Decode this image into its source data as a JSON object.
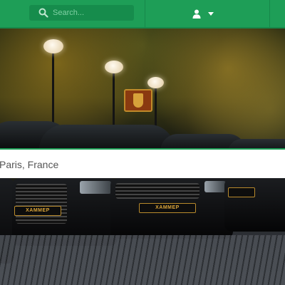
{
  "navbar": {
    "search": {
      "placeholder": "Search...",
      "icon": "search-icon"
    },
    "user_menu": {
      "icon": "user-icon",
      "dropdown_icon": "caret-down-icon"
    },
    "colors": {
      "background": "#1e9e57",
      "search_background": "#168c4c"
    }
  },
  "hero": {
    "emblem": "emblem-logo",
    "plates": [
      "XAMMEP",
      "XAMMEP"
    ],
    "location": "Paris, France"
  }
}
